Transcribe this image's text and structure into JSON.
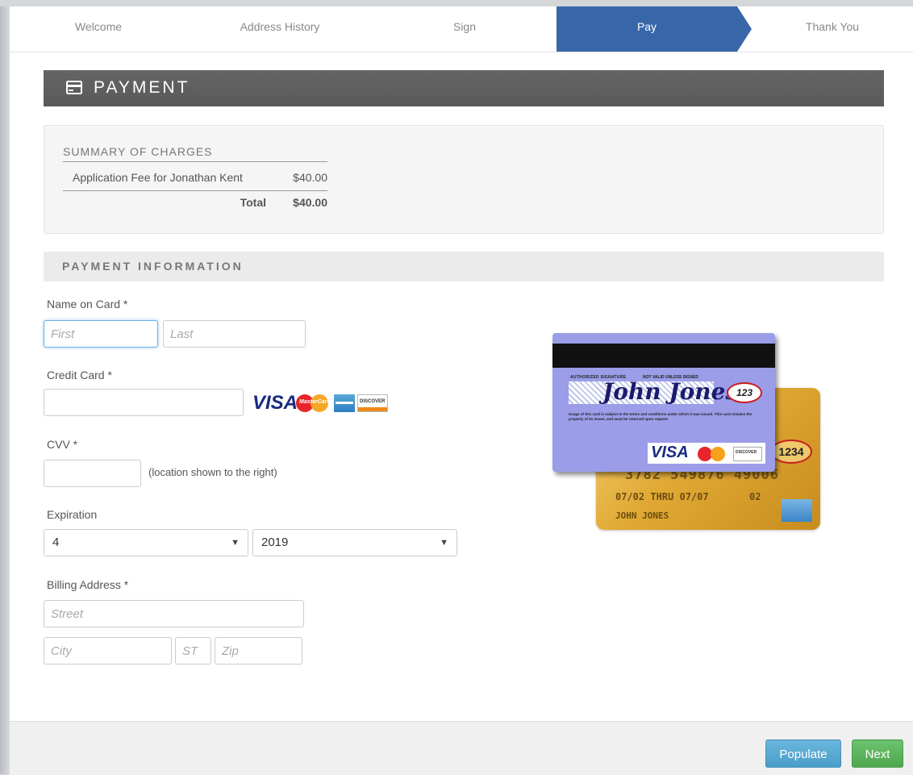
{
  "steps": [
    {
      "label": "Welcome",
      "active": false
    },
    {
      "label": "Address History",
      "active": false
    },
    {
      "label": "Sign",
      "active": false
    },
    {
      "label": "Pay",
      "active": true
    },
    {
      "label": "Thank You",
      "active": false
    }
  ],
  "header": {
    "title": "PAYMENT",
    "icon": "credit-card-icon"
  },
  "summary": {
    "heading": "SUMMARY OF CHARGES",
    "items": [
      {
        "description": "Application Fee for Jonathan Kent",
        "amount": "$40.00"
      }
    ],
    "total_label": "Total",
    "total_amount": "$40.00"
  },
  "payment_info": {
    "heading": "PAYMENT INFORMATION",
    "name_label": "Name on Card *",
    "first_placeholder": "First",
    "last_placeholder": "Last",
    "card_label": "Credit Card *",
    "card_logos": {
      "visa": "VISA",
      "mastercard": "MasterCard",
      "discover": "DISCOVER"
    },
    "cvv_label": "CVV *",
    "cvv_hint": "(location shown to the right)",
    "expiration_label": "Expiration",
    "exp_month": "4",
    "exp_year": "2019",
    "billing_label": "Billing Address *",
    "street_placeholder": "Street",
    "city_placeholder": "City",
    "state_placeholder": "ST",
    "zip_placeholder": "Zip"
  },
  "card_illustration": {
    "back_signature_caption": "AUTHORIZED SIGNATURE",
    "back_valid_caption": "NOT VALID UNLESS SIGNED",
    "back_signature": "John Jones",
    "back_cvv": "123",
    "back_fine_print": "Usage of this card is subject to the terms and conditions under which it was issued. This card remains the property of its issuer, and must be returned upon request.",
    "back_visa": "VISA",
    "back_discover": "DISCOVER",
    "front_cvv": "1234",
    "front_number": "3782 549876 49006",
    "front_dates": "07/02 THRU 07/07",
    "front_member": "02",
    "front_name": "JOHN JONES"
  },
  "footer": {
    "populate_label": "Populate",
    "next_label": "Next"
  },
  "colors": {
    "accent": "#3867a9",
    "populate": "#5aaad3",
    "next": "#5cb85c"
  }
}
